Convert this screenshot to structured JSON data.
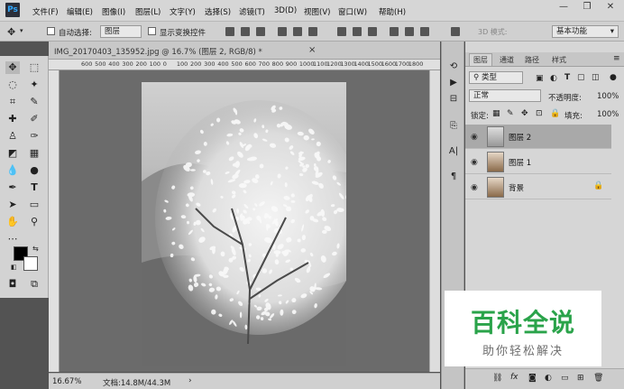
{
  "app": {
    "logo": "Ps"
  },
  "menu": [
    "文件(F)",
    "编辑(E)",
    "图像(I)",
    "图层(L)",
    "文字(Y)",
    "选择(S)",
    "滤镜(T)",
    "3D(D)",
    "视图(V)",
    "窗口(W)",
    "帮助(H)"
  ],
  "window_controls": {
    "minimize": "—",
    "restore": "❐",
    "close": "✕"
  },
  "options": {
    "auto_select_label": "自动选择:",
    "auto_select_value": "图层",
    "show_transform_label": "显示变换控件",
    "mode_3d_label": "3D 模式:",
    "workspace_value": "基本功能"
  },
  "document": {
    "tab_label": "IMG_20170403_135952.jpg @ 16.7% (图层 2, RGB/8) *",
    "close_glyph": "×",
    "ruler_ticks": [
      "600",
      "500",
      "400",
      "300",
      "200",
      "100",
      "0",
      "100",
      "200",
      "300",
      "400",
      "500",
      "600",
      "700",
      "800",
      "900",
      "1000",
      "1100",
      "1200",
      "1300",
      "1400",
      "1500",
      "1600",
      "1700",
      "1800"
    ]
  },
  "status": {
    "zoom": "16.67%",
    "doc_info": "文档:14.8M/44.3M"
  },
  "layers_panel": {
    "tabs": [
      "图层",
      "通道",
      "路径",
      "样式"
    ],
    "filter_label": "类型",
    "blend_mode": "正常",
    "opacity_label": "不透明度:",
    "opacity_value": "100%",
    "lock_label": "锁定:",
    "fill_label": "填充:",
    "fill_value": "100%",
    "layers": [
      {
        "name": "图层 2",
        "selected": true
      },
      {
        "name": "图层 1",
        "selected": false
      },
      {
        "name": "背景",
        "selected": false,
        "locked": true
      }
    ]
  },
  "watermark": {
    "title": "百科全说",
    "subtitle": "助你轻松解决"
  },
  "colors": {
    "accent_green": "#2aa34a",
    "ps_blue": "#31a8ff"
  }
}
